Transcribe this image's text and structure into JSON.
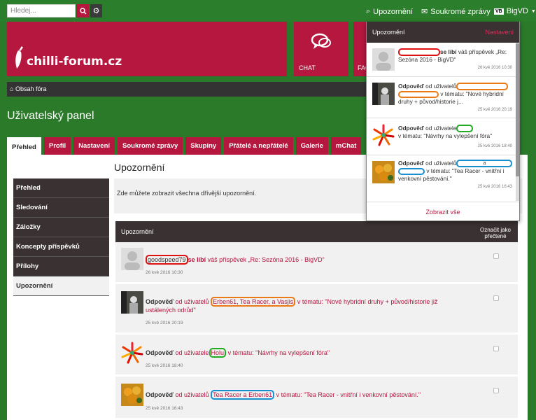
{
  "search": {
    "placeholder": "Hledej..."
  },
  "topnav": {
    "notifications": "Upozornění",
    "messages": "Soukromé zprávy",
    "user": "BigVD"
  },
  "header": {
    "logo": "chilli-forum.cz",
    "chat": "CHAT",
    "fac": "FAC"
  },
  "breadcrumb": {
    "home": "Obsah fóra"
  },
  "page": {
    "title": "Uživatelský panel"
  },
  "tabs": [
    "Přehled",
    "Profil",
    "Nastavení",
    "Soukromé zprávy",
    "Skupiny",
    "Přátelé a nepřátelé",
    "Galerie",
    "mChat"
  ],
  "sidebar": [
    "Přehled",
    "Sledování",
    "Záložky",
    "Koncepty příspěvků",
    "Přílohy",
    "Upozornění"
  ],
  "section": {
    "title": "Upozornění",
    "info": "Zde můžete zobrazit všechna dřívější upozornění.",
    "col_notif": "Upozornění",
    "col_mark": "Označit jako přečtené"
  },
  "rows": [
    {
      "user": "goodspeed79",
      "verb": "se líbí",
      "rest": "váš příspěvek „Re: Sezóna 2016 - BigVD“",
      "time": "26 kvě 2016 10:30"
    },
    {
      "title": "Odpověď",
      "pre": "od uživatelů",
      "users": "Erben61, Tea Racer, a Vasjis",
      "rest": "v tématu: \"Nové hybridní druhy + původ/historie již ustálených odrůd\"",
      "time": "25 kvě 2016 20:19"
    },
    {
      "title": "Odpověď",
      "pre": "od uživatele",
      "users": "Holu",
      "rest": "v tématu: \"Návrhy na vylepšení fóra\"",
      "time": "25 kvě 2016 18:40"
    },
    {
      "title": "Odpověď",
      "pre": "od uživatelů",
      "users": "Tea Racer a Erben61",
      "rest": "v tématu: \"Tea Racer - vnitřní i venkovní pěstování.\"",
      "time": "25 kvě 2016 16:43"
    }
  ],
  "dropdown": {
    "title": "Upozornění",
    "settings": "Nastavení",
    "footer": "Zobrazit vše",
    "items": [
      {
        "verb": "se líbí",
        "rest": "váš příspěvek „Re: Sezóna 2016 - BigVD“",
        "time": "26 kvě 2016 10:30"
      },
      {
        "title": "Odpověď",
        "pre": "od uživatelů",
        "mid": ", a",
        "rest": "v tématu: \"Nové hybridní druhy + původ/historie j...",
        "time": "25 kvě 2016 20:19"
      },
      {
        "title": "Odpověď",
        "pre": "od uživatele",
        "rest": "v tématu: \"Návrhy na vylepšení fóra\"",
        "time": "25 kvě 2016 18:40"
      },
      {
        "title": "Odpověď",
        "pre": "od uživatelů",
        "a": "a",
        "rest": "v tématu: \"Tea Racer - vnitřní i venkovní pěstování.\"",
        "time": "25 kvě 2016 16:43"
      }
    ]
  },
  "colors": {
    "accent": "#b5173f",
    "green": "#2b7e2b",
    "dark": "#3a3232"
  }
}
